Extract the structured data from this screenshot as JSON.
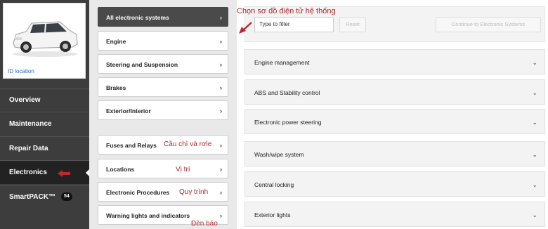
{
  "vehicle": {
    "id_location_label": "ID location"
  },
  "nav": {
    "items": [
      {
        "label": "Overview"
      },
      {
        "label": "Maintenance"
      },
      {
        "label": "Repair Data"
      },
      {
        "label": "Electronics"
      },
      {
        "label": "SmartPACK™",
        "badge": "54"
      }
    ]
  },
  "systems": {
    "top": [
      {
        "label": "All electronic systems"
      },
      {
        "label": "Engine"
      },
      {
        "label": "Steering and Suspension"
      },
      {
        "label": "Brakes"
      },
      {
        "label": "Exterior/Interior"
      }
    ],
    "bottom": [
      {
        "label": "Fuses and Relays"
      },
      {
        "label": "Locations"
      },
      {
        "label": "Electronic Procedures"
      },
      {
        "label": "Warning lights and indicators"
      }
    ]
  },
  "annotations": {
    "select_diagram": "Chọn sơ đồ điện tử hệ thống",
    "fuses": "Cầu chì và rơle",
    "locations": "Vị trí",
    "procedures": "Quy trình",
    "warning": "Đèn báo"
  },
  "toolbar": {
    "filter_placeholder": "Type to filter",
    "reset_label": "Reset",
    "continue_label": "Continue to Electronic Systems"
  },
  "accordion": [
    {
      "label": "Engine management"
    },
    {
      "label": "ABS and Stability control"
    },
    {
      "label": "Electronic power steering"
    },
    {
      "label": "Wash/wipe system"
    },
    {
      "label": "Central locking"
    },
    {
      "label": "Exterior lights"
    }
  ],
  "colors": {
    "annotation": "#b0282c",
    "sidebar": "#3d3d3d",
    "link": "#2a6ebb"
  }
}
